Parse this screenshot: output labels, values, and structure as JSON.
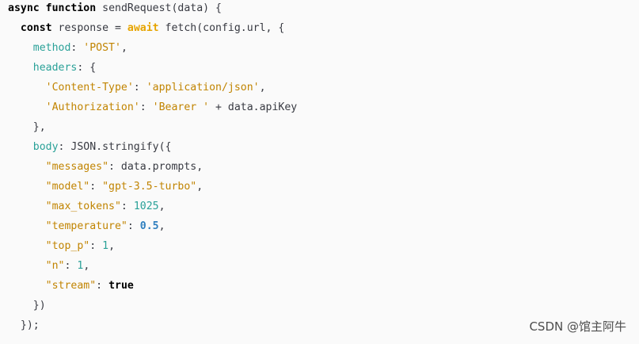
{
  "code": {
    "lines": [
      {
        "tokens": [
          {
            "t": "async",
            "k": "kw"
          },
          {
            "t": " ",
            "k": "pl"
          },
          {
            "t": "function",
            "k": "kw"
          },
          {
            "t": " sendRequest(data) {",
            "k": "pl"
          }
        ]
      },
      {
        "tokens": [
          {
            "t": "  ",
            "k": "pl"
          },
          {
            "t": "const",
            "k": "kw"
          },
          {
            "t": " response = ",
            "k": "pl"
          },
          {
            "t": "await",
            "k": "aw"
          },
          {
            "t": " fetch(config.url, {",
            "k": "pl"
          }
        ]
      },
      {
        "tokens": [
          {
            "t": "    ",
            "k": "pl"
          },
          {
            "t": "method",
            "k": "prop"
          },
          {
            "t": ": ",
            "k": "pl"
          },
          {
            "t": "'POST'",
            "k": "str"
          },
          {
            "t": ",",
            "k": "pl"
          }
        ]
      },
      {
        "tokens": [
          {
            "t": "    ",
            "k": "pl"
          },
          {
            "t": "headers",
            "k": "prop"
          },
          {
            "t": ": {",
            "k": "pl"
          }
        ]
      },
      {
        "tokens": [
          {
            "t": "      ",
            "k": "pl"
          },
          {
            "t": "'Content-Type'",
            "k": "str"
          },
          {
            "t": ": ",
            "k": "pl"
          },
          {
            "t": "'application/json'",
            "k": "str"
          },
          {
            "t": ",",
            "k": "pl"
          }
        ]
      },
      {
        "tokens": [
          {
            "t": "      ",
            "k": "pl"
          },
          {
            "t": "'Authorization'",
            "k": "str"
          },
          {
            "t": ": ",
            "k": "pl"
          },
          {
            "t": "'Bearer '",
            "k": "str"
          },
          {
            "t": " + data.apiKey",
            "k": "pl"
          }
        ]
      },
      {
        "tokens": [
          {
            "t": "    },",
            "k": "pl"
          }
        ]
      },
      {
        "tokens": [
          {
            "t": "    ",
            "k": "pl"
          },
          {
            "t": "body",
            "k": "prop"
          },
          {
            "t": ": JSON.stringify({",
            "k": "pl"
          }
        ]
      },
      {
        "tokens": [
          {
            "t": "      ",
            "k": "pl"
          },
          {
            "t": "\"messages\"",
            "k": "str"
          },
          {
            "t": ": data.prompts,",
            "k": "pl"
          }
        ]
      },
      {
        "tokens": [
          {
            "t": "      ",
            "k": "pl"
          },
          {
            "t": "\"model\"",
            "k": "str"
          },
          {
            "t": ": ",
            "k": "pl"
          },
          {
            "t": "\"gpt-3.5-turbo\"",
            "k": "str"
          },
          {
            "t": ",",
            "k": "pl"
          }
        ]
      },
      {
        "tokens": [
          {
            "t": "      ",
            "k": "pl"
          },
          {
            "t": "\"max_tokens\"",
            "k": "str"
          },
          {
            "t": ": ",
            "k": "pl"
          },
          {
            "t": "1025",
            "k": "num"
          },
          {
            "t": ",",
            "k": "pl"
          }
        ]
      },
      {
        "tokens": [
          {
            "t": "      ",
            "k": "pl"
          },
          {
            "t": "\"temperature\"",
            "k": "str"
          },
          {
            "t": ": ",
            "k": "pl"
          },
          {
            "t": "0.5",
            "k": "numb"
          },
          {
            "t": ",",
            "k": "pl"
          }
        ]
      },
      {
        "tokens": [
          {
            "t": "      ",
            "k": "pl"
          },
          {
            "t": "\"top_p\"",
            "k": "str"
          },
          {
            "t": ": ",
            "k": "pl"
          },
          {
            "t": "1",
            "k": "num"
          },
          {
            "t": ",",
            "k": "pl"
          }
        ]
      },
      {
        "tokens": [
          {
            "t": "      ",
            "k": "pl"
          },
          {
            "t": "\"n\"",
            "k": "str"
          },
          {
            "t": ": ",
            "k": "pl"
          },
          {
            "t": "1",
            "k": "num"
          },
          {
            "t": ",",
            "k": "pl"
          }
        ]
      },
      {
        "tokens": [
          {
            "t": "      ",
            "k": "pl"
          },
          {
            "t": "\"stream\"",
            "k": "str"
          },
          {
            "t": ": ",
            "k": "pl"
          },
          {
            "t": "true",
            "k": "lit"
          }
        ]
      },
      {
        "tokens": [
          {
            "t": "    })",
            "k": "pl"
          }
        ]
      },
      {
        "tokens": [
          {
            "t": "  });",
            "k": "pl"
          }
        ]
      }
    ]
  },
  "watermark": {
    "text": "CSDN @馆主阿牛"
  },
  "colors": {
    "background": "#fafafa",
    "keyword": "#000000",
    "await": "#e6a400",
    "property": "#2aa198",
    "string": "#c18401",
    "number": "#2aa198",
    "number_bold": "#2f7fbf",
    "plain": "#383a42"
  }
}
